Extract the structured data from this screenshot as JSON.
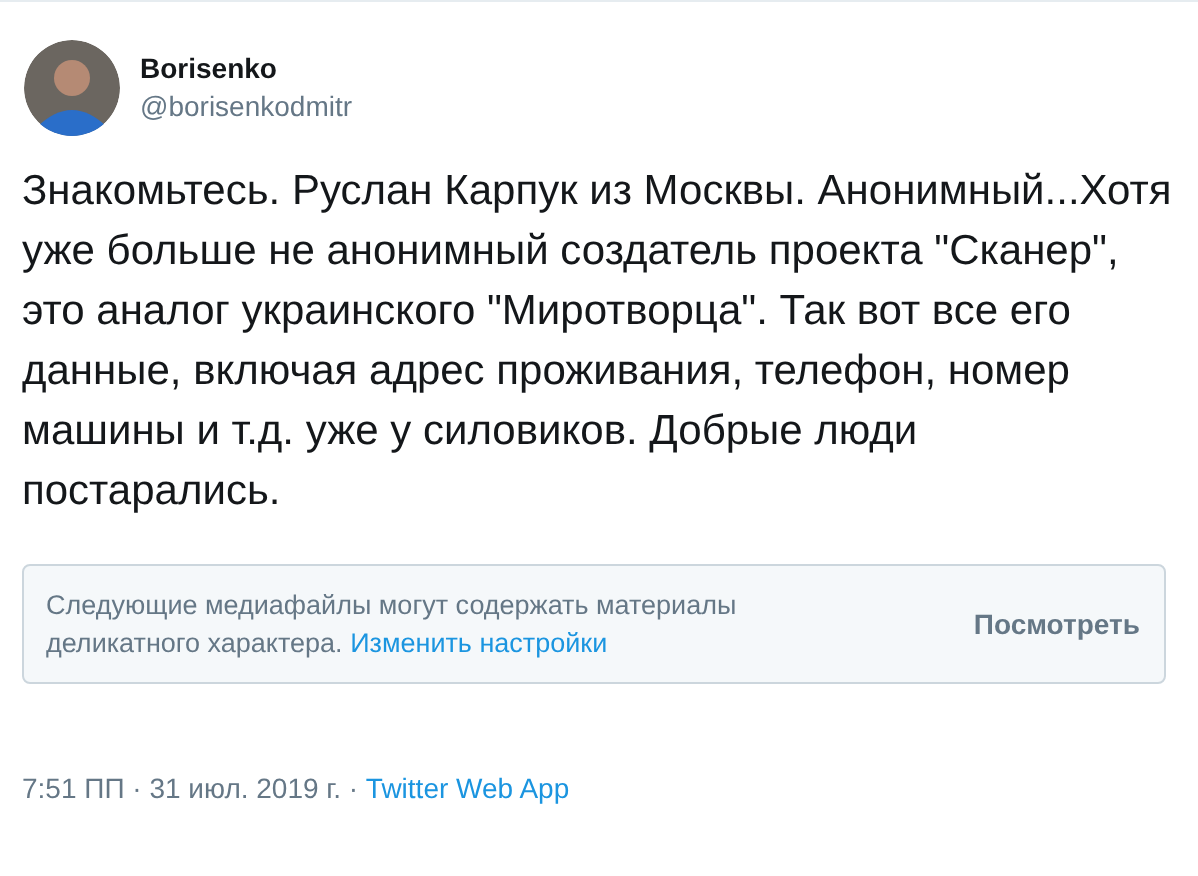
{
  "author": {
    "name": "Borisenko",
    "handle": "@borisenkodmitr"
  },
  "tweet_text": "Знакомьтесь. Руслан Карпук из Москвы. Анонимный...Хотя уже больше не анонимный создатель проекта \"Сканер\", это аналог украинского \"Миротворца\". Так вот все его данные, включая адрес проживания, телефон, номер машины и т.д. уже у силовиков. Добрые люди постарались.",
  "sensitive_notice": {
    "text": "Следующие медиафайлы могут содержать материалы деликатного характера.",
    "link": "Изменить настройки",
    "button": "Посмотреть"
  },
  "footer": {
    "time": "7:51 ПП",
    "date": "31 июл. 2019 г.",
    "separator": "·",
    "source": "Twitter Web App"
  }
}
